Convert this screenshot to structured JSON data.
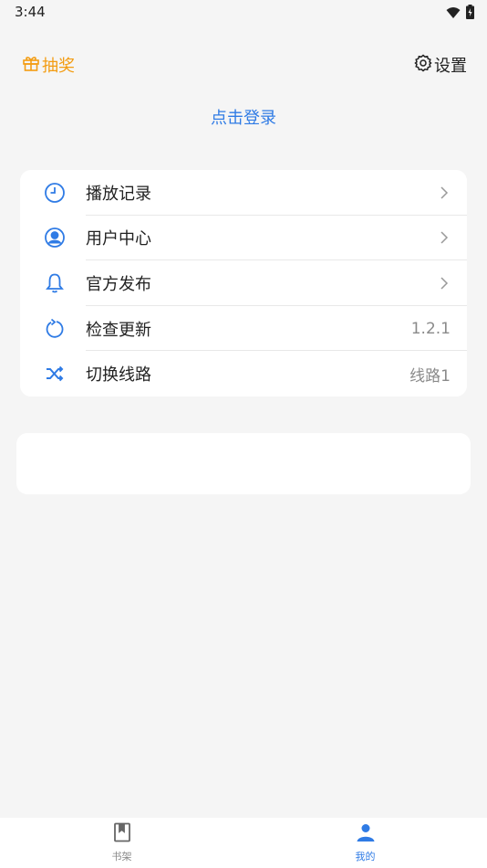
{
  "status_bar": {
    "time": "3:44"
  },
  "header": {
    "lottery_label": "抽奖",
    "settings_label": "设置"
  },
  "login": {
    "label": "点击登录"
  },
  "menu": {
    "items": [
      {
        "label": "播放记录",
        "icon": "clock-icon",
        "value": "",
        "has_chevron": true
      },
      {
        "label": "用户中心",
        "icon": "user-circle-icon",
        "value": "",
        "has_chevron": true
      },
      {
        "label": "官方发布",
        "icon": "bell-icon",
        "value": "",
        "has_chevron": true
      },
      {
        "label": "检查更新",
        "icon": "refresh-icon",
        "value": "1.2.1",
        "has_chevron": false
      },
      {
        "label": "切换线路",
        "icon": "shuffle-icon",
        "value": "线路1",
        "has_chevron": false
      }
    ]
  },
  "bottom_nav": {
    "shelf_label": "书架",
    "mine_label": "我的",
    "active": "mine"
  },
  "colors": {
    "accent": "#2f7be5",
    "lottery": "#f39c12",
    "background": "#f5f5f5"
  }
}
